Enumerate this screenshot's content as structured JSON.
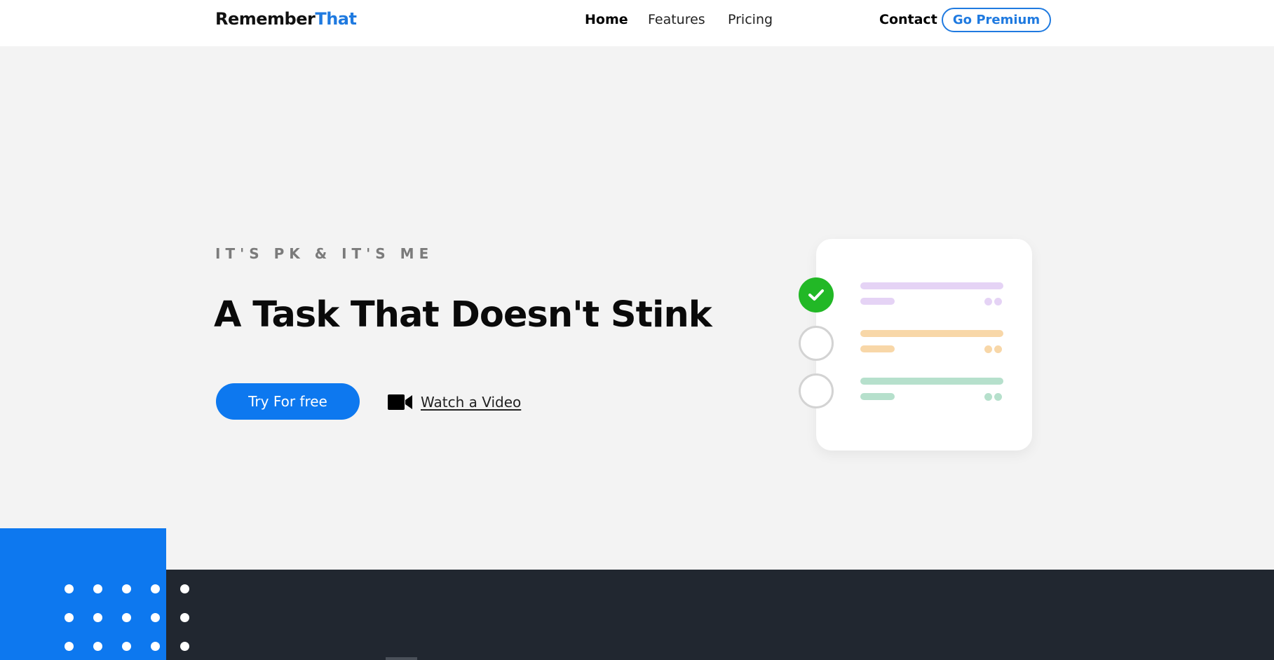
{
  "nav": {
    "logo_primary": "Remember",
    "logo_accent": "That",
    "links": [
      {
        "label": "Home",
        "active": true
      },
      {
        "label": "Features",
        "active": false
      },
      {
        "label": "Pricing",
        "active": false
      }
    ],
    "contact_label": "Contact",
    "premium_label": "Go Premium"
  },
  "hero": {
    "eyebrow": "IT'S PK & IT'S ME",
    "headline": "A Task That Doesn't Stink",
    "cta_label": "Try For free",
    "video_label": "Watch a Video",
    "video_icon": "video-camera-icon"
  },
  "illustration": {
    "tasks": [
      {
        "status": "done",
        "color": "#e5d3f5",
        "dot_color": "#e5d3f5"
      },
      {
        "status": "open",
        "color": "#f8d7a8",
        "dot_color": "#f8d7a8"
      },
      {
        "status": "open",
        "color": "#b6e0cc",
        "dot_color": "#b6e0cc"
      }
    ]
  },
  "colors": {
    "accent": "#0d78ef",
    "brand_blue": "#1f7ae0",
    "success": "#22b826",
    "dark_band": "#212730",
    "hero_bg": "#f3f3f3"
  }
}
